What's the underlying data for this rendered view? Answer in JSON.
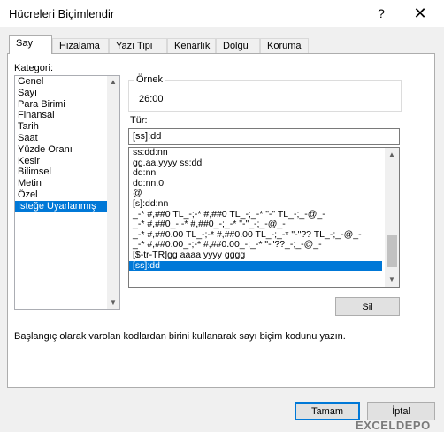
{
  "window": {
    "title": "Hücreleri Biçimlendir",
    "help_glyph": "?",
    "close_glyph": "✕"
  },
  "tabs": [
    "Sayı",
    "Hizalama",
    "Yazı Tipi",
    "Kenarlık",
    "Dolgu",
    "Koruma"
  ],
  "active_tab": "Sayı",
  "kategori": {
    "label": "Kategori:",
    "items": [
      "Genel",
      "Sayı",
      "Para Birimi",
      "Finansal",
      "Tarih",
      "Saat",
      "Yüzde Oranı",
      "Kesir",
      "Bilimsel",
      "Metin",
      "Özel",
      "İsteğe Uyarlanmış"
    ],
    "selected": "İsteğe Uyarlanmış"
  },
  "ornek": {
    "label": "Örnek",
    "value": "26:00"
  },
  "tur": {
    "label": "Tür:",
    "value": "[ss]:dd",
    "list": [
      "ss:dd:nn",
      "gg.aa.yyyy ss:dd",
      "dd:nn",
      "dd:nn.0",
      "@",
      "[s]:dd:nn",
      "_-* #,##0 TL_-;-* #,##0 TL_-;_-* \"-\" TL_-;_-@_-",
      "_-* #,##0_-;-* #,##0_-;_-* \"-\"_-;_-@_-",
      "_-* #,##0.00 TL_-;-* #,##0.00 TL_-;_-* \"-\"?? TL_-;_-@_-",
      "_-* #,##0.00_-;-* #,##0.00_-;_-* \"-\"??_-;_-@_-",
      "[$-tr-TR]gg aaaa yyyy gggg",
      "[ss]:dd"
    ],
    "selected": "[ss]:dd"
  },
  "buttons": {
    "sil": "Sil",
    "tamam": "Tamam",
    "iptal": "İptal"
  },
  "hint": "Başlangıç olarak varolan kodlardan birini kullanarak sayı biçim kodunu yazın.",
  "watermark": "EXCELDEPO",
  "colors": {
    "selection": "#0078d7",
    "dialog_bg": "#f0f0f0"
  }
}
